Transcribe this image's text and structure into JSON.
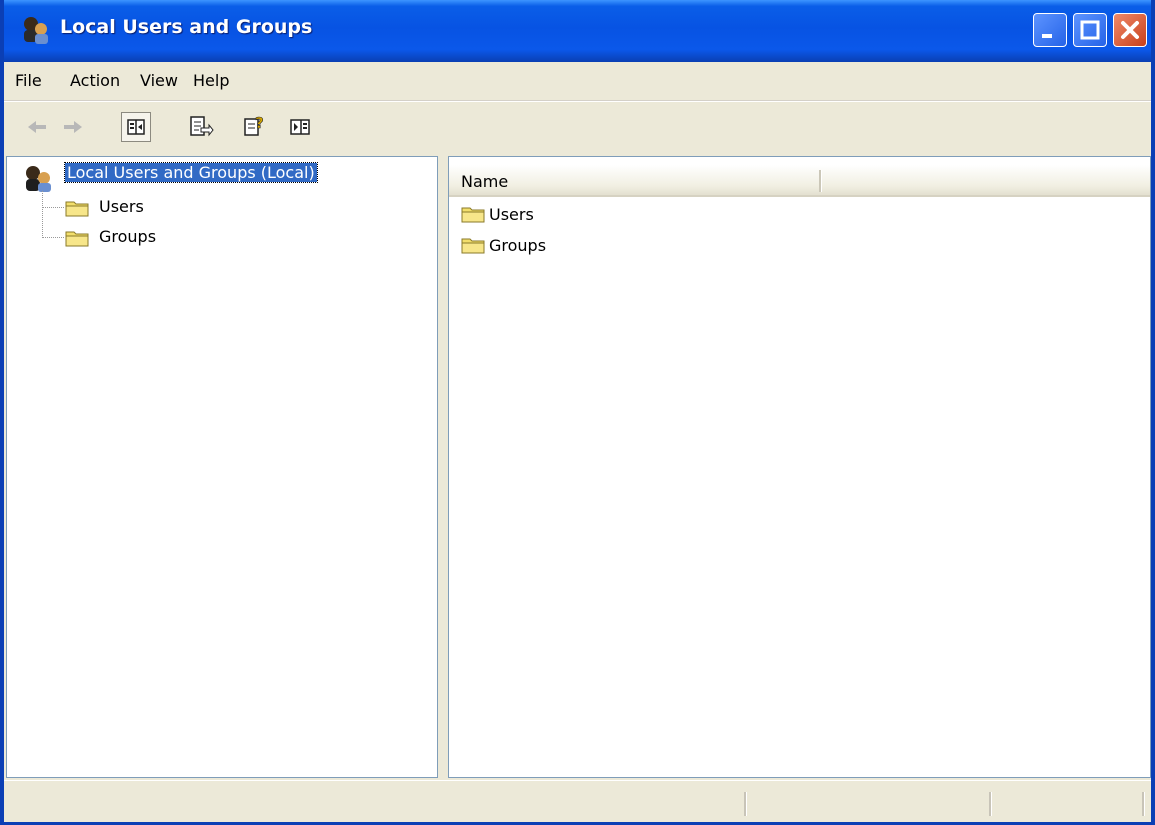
{
  "window": {
    "title": "Local Users and Groups"
  },
  "menu": {
    "file": "File",
    "action": "Action",
    "view": "View",
    "help": "Help"
  },
  "toolbar": {
    "buttons": [
      "back-icon",
      "forward-icon",
      "show-hide-console-tree-icon",
      "export-list-icon",
      "help-icon",
      "show-hide-action-pane-icon"
    ]
  },
  "tree": {
    "root": "Local Users and Groups (Local)",
    "children": [
      "Users",
      "Groups"
    ]
  },
  "list": {
    "column_name": "Name",
    "items": [
      "Users",
      "Groups"
    ]
  },
  "colors": {
    "titlebar": "#0753e3",
    "selection": "#316ac5",
    "folder": "#f2de6b"
  }
}
